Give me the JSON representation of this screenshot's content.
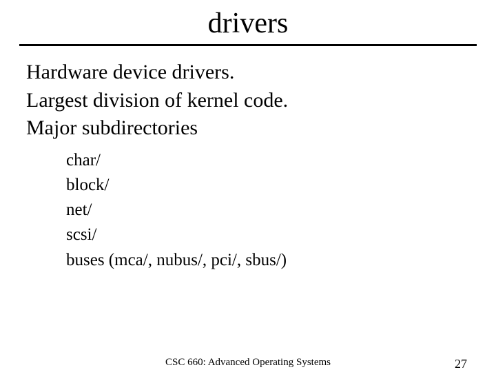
{
  "title": "drivers",
  "body": {
    "lines": [
      "Hardware device drivers.",
      "Largest division of kernel code.",
      "Major subdirectories"
    ],
    "sublist": [
      "char/",
      "block/",
      "net/",
      "scsi/",
      "buses (mca/, nubus/, pci/, sbus/)"
    ]
  },
  "footer": {
    "course": "CSC 660: Advanced Operating Systems",
    "page": "27"
  }
}
